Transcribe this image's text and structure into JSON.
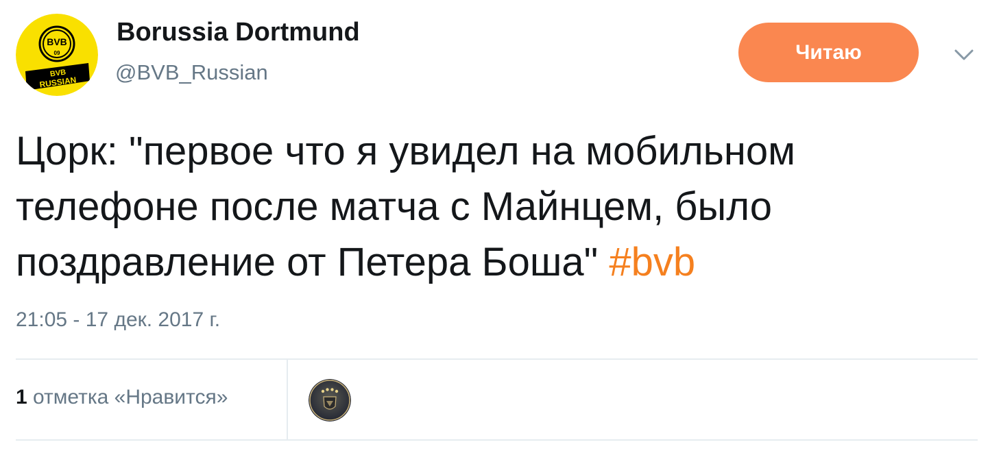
{
  "author": {
    "display_name": "Borussia Dortmund",
    "handle": "@BVB_Russian",
    "avatar_icon": "bvb-russian-logo",
    "avatar_logo_text": [
      "BVB",
      "09",
      "BVB",
      "RUSSIAN"
    ]
  },
  "follow_button": {
    "label": "Читаю",
    "color": "#fa8750"
  },
  "menu_icon": "chevron-down-icon",
  "tweet": {
    "text": "Цорк: \"первое что я увидел на мобильном телефоне после матча с Майнцем, было поздравление от Петера Боша\" ",
    "hashtag": "#bvb",
    "hashtag_color": "#f5801f",
    "timestamp": "21:05 - 17 дек. 2017 г."
  },
  "stats": {
    "likes_count": "1",
    "likes_label": " отметка «Нравится»",
    "liker_avatar_icon": "germany-national-team-crest"
  }
}
